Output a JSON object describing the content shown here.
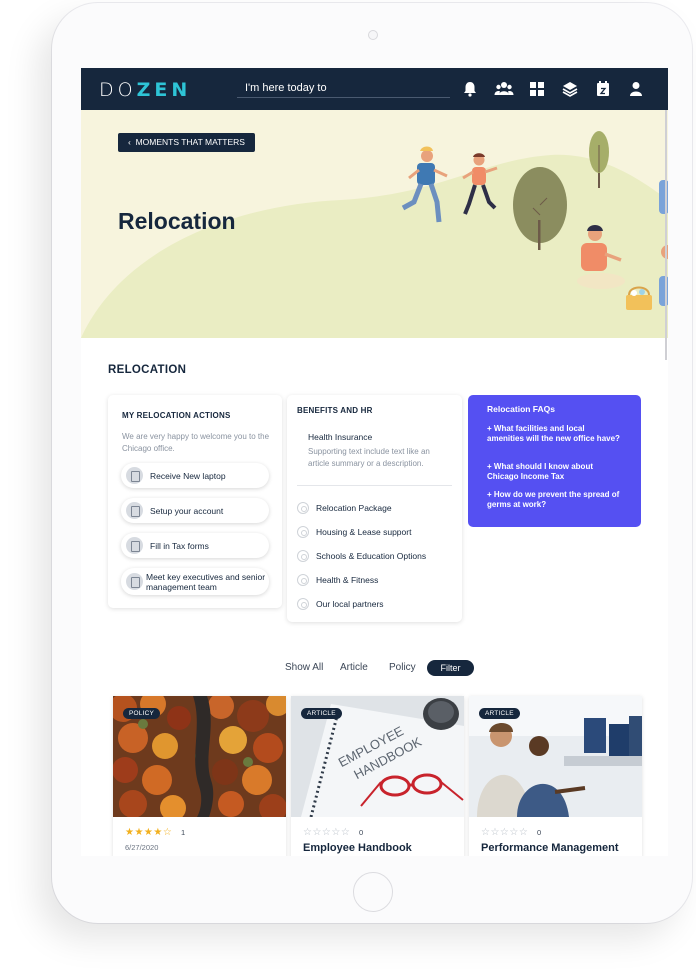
{
  "brand": {
    "logo_prefix": "DO",
    "logo_suffix": "ZEN"
  },
  "search": {
    "placeholder": "I'm here today to"
  },
  "header_icons": [
    "bell-icon",
    "group-icon",
    "grid-icon",
    "layers-icon",
    "calendar-icon",
    "user-icon"
  ],
  "hero": {
    "back_label": "MOMENTS THAT MATTERS",
    "title": "Relocation"
  },
  "section": {
    "title": "RELOCATION"
  },
  "actions_card": {
    "heading": "MY RELOCATION ACTIONS",
    "intro": "We are very happy to welcome you to the Chicago office.",
    "items": [
      "Receive New laptop",
      "Setup your account",
      "Fill in Tax forms",
      "Meet key executives and senior management team"
    ]
  },
  "benefits_card": {
    "heading": "BENEFITS AND HR",
    "featured_title": "Health Insurance",
    "featured_text": "Supporting text include text like an article summary or a description.",
    "items": [
      "Relocation Package",
      "Housing & Lease support",
      "Schools & Education Options",
      "Health & Fitness",
      "Our local partners"
    ]
  },
  "faq_card": {
    "heading": "Relocation FAQs",
    "questions": [
      "+ What facilities and local amenities will the new office have?",
      "+ What should I know about Chicago Income Tax",
      "+ How do we prevent the spread of germs at work?"
    ]
  },
  "filters": {
    "show_all": "Show All",
    "article": "Article",
    "policy": "Policy",
    "filter": "Filter"
  },
  "posts": [
    {
      "badge": "POLICY",
      "stars": "★★★★☆",
      "rating_count": "1",
      "date": "6/27/2020",
      "title": ""
    },
    {
      "badge": "ARTICLE",
      "stars": "☆☆☆☆☆",
      "rating_count": "0",
      "date": "",
      "title": "Employee Handbook",
      "image_text_1": "EMPLOYEE",
      "image_text_2": "HANDBOOK"
    },
    {
      "badge": "ARTICLE",
      "stars": "☆☆☆☆☆",
      "rating_count": "0",
      "date": "",
      "title": "Performance Management"
    }
  ],
  "colors": {
    "navy": "#16273d",
    "accent_cyan": "#2ec4d6",
    "faq_purple": "#5550f2",
    "hero_bg": "#f7f4dd",
    "star_gold": "#f2b01e"
  }
}
